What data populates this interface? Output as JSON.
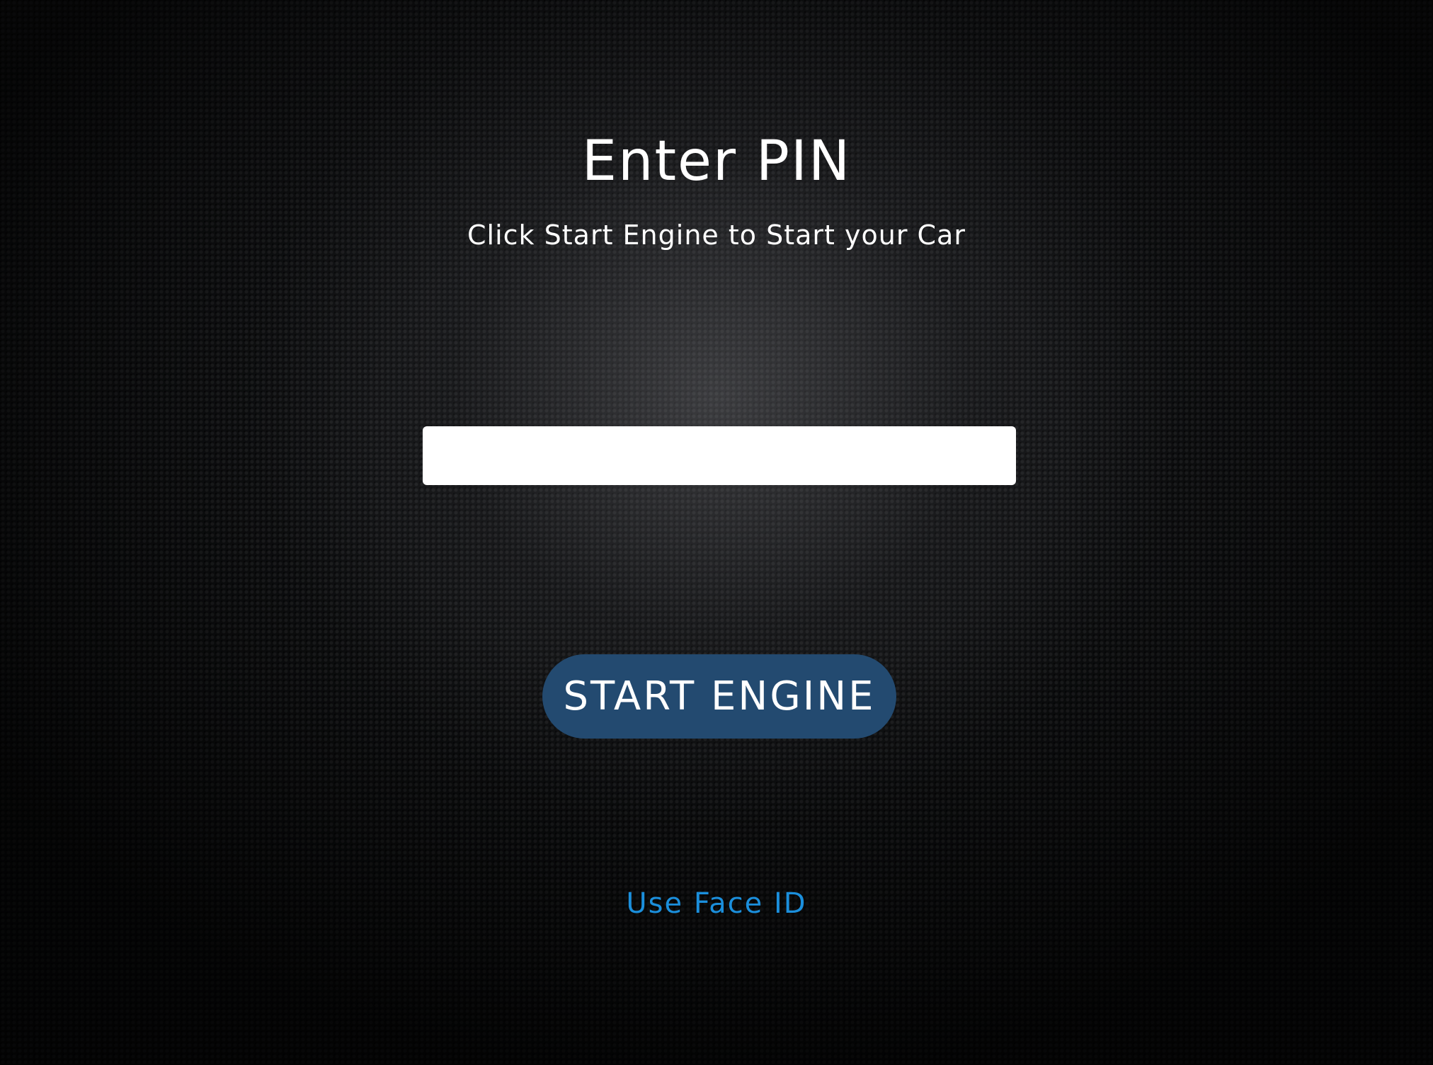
{
  "screen": {
    "title": "Enter PIN",
    "subtitle": "Click Start Engine to Start your Car"
  },
  "pin_input": {
    "value": "",
    "placeholder": ""
  },
  "actions": {
    "start_engine_label": "START ENGINE",
    "face_id_label": "Use Face ID"
  },
  "colors": {
    "background": "#111214",
    "button": "#234a70",
    "link": "#1b8fdc",
    "text": "#ffffff"
  }
}
